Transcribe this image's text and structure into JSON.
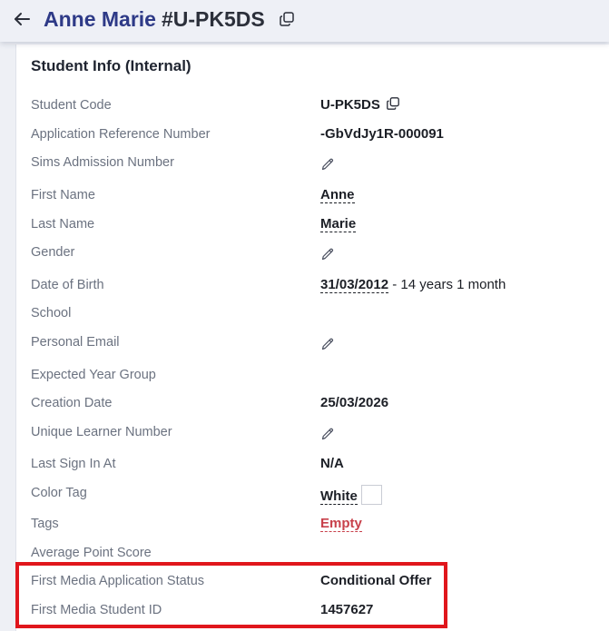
{
  "header": {
    "back_icon": "arrow-left-icon",
    "name": "Anne Marie",
    "code": "#U-PK5DS",
    "copy_icon": "copy-icon"
  },
  "section": {
    "title": "Student Info (Internal)"
  },
  "fields": {
    "student_code": {
      "label": "Student Code",
      "value": "U-PK5DS"
    },
    "app_ref": {
      "label": "Application Reference Number",
      "value": "-GbVdJy1R-000091"
    },
    "sims": {
      "label": "Sims Admission Number"
    },
    "first_name": {
      "label": "First Name",
      "value": "Anne"
    },
    "last_name": {
      "label": "Last Name",
      "value": "Marie"
    },
    "gender": {
      "label": "Gender"
    },
    "dob": {
      "label": "Date of Birth",
      "value": "31/03/2012",
      "suffix": " - 14 years 1 month"
    },
    "school": {
      "label": "School"
    },
    "personal_email": {
      "label": "Personal Email"
    },
    "expected_year": {
      "label": "Expected Year Group"
    },
    "creation_date": {
      "label": "Creation Date",
      "value": "25/03/2026"
    },
    "uln": {
      "label": "Unique Learner Number"
    },
    "last_sign_in": {
      "label": "Last Sign In At",
      "value": "N/A"
    },
    "color_tag": {
      "label": "Color Tag",
      "value": "White",
      "swatch_color": "#ffffff"
    },
    "tags": {
      "label": "Tags",
      "value": "Empty"
    },
    "aps": {
      "label": "Average Point Score"
    },
    "fm_status": {
      "label": "First Media Application Status",
      "value": "Conditional Offer"
    },
    "fm_student_id": {
      "label": "First Media Student ID",
      "value": "1457627"
    }
  },
  "colors": {
    "title_name": "#2e3a87",
    "empty_tag": "#c8414b",
    "highlight_border": "#e0161c"
  }
}
